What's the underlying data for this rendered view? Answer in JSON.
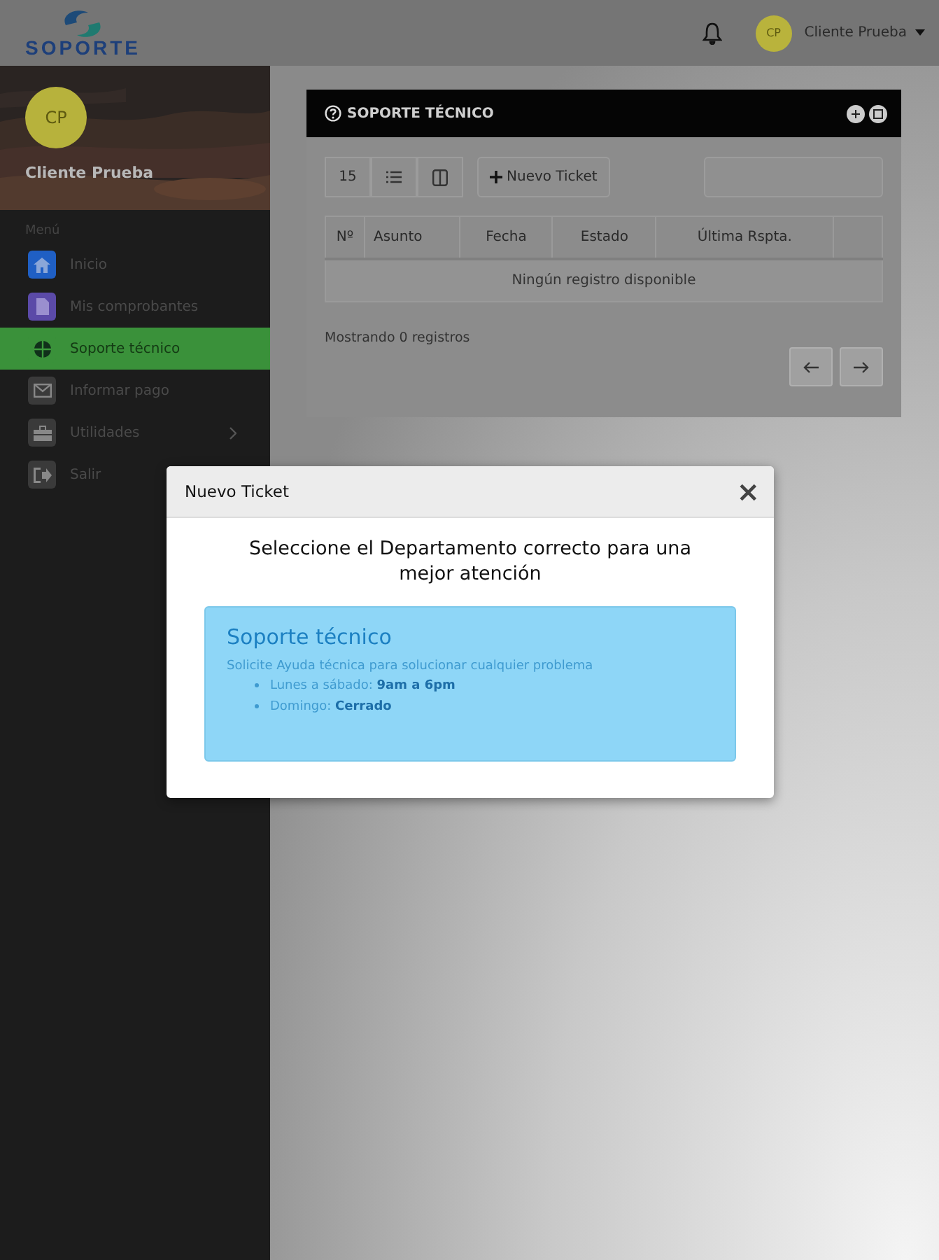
{
  "header": {
    "logo_text": "SOPORTE",
    "user": {
      "initials": "CP",
      "name": "Cliente Prueba"
    }
  },
  "sidebar": {
    "profile": {
      "initials": "CP",
      "name": "Cliente Prueba"
    },
    "section_label": "Menú",
    "items": [
      {
        "label": "Inicio",
        "kind": "home",
        "color": "#1f5fc4",
        "selected": false,
        "has_submenu": false
      },
      {
        "label": "Mis comprobantes",
        "kind": "document",
        "color": "#5b4aa8",
        "selected": false,
        "has_submenu": false
      },
      {
        "label": "Soporte técnico",
        "kind": "globe",
        "color": "#3a913a",
        "selected": true,
        "has_submenu": false
      },
      {
        "label": "Informar pago",
        "kind": "mail",
        "color": "#3a3a3a",
        "selected": false,
        "has_submenu": false
      },
      {
        "label": "Utilidades",
        "kind": "toolbox",
        "color": "#3a3a3a",
        "selected": false,
        "has_submenu": true
      },
      {
        "label": "Salir",
        "kind": "exit",
        "color": "#3a3a3a",
        "selected": false,
        "has_submenu": false
      }
    ]
  },
  "panel": {
    "title": "SOPORTE TÉCNICO",
    "page_size": "15",
    "new_button": "Nuevo Ticket",
    "columns": [
      "Nº",
      "Asunto",
      "Fecha",
      "Estado",
      "Última Rspta."
    ],
    "empty_message": "Ningún registro disponible",
    "footer": "Mostrando 0 registros"
  },
  "modal": {
    "title": "Nuevo Ticket",
    "close": "×",
    "heading": "Seleccione el Departamento correcto para una mejor atención",
    "departments": [
      {
        "title": "Soporte técnico",
        "description": "Solicite Ayuda técnica para solucionar cualquier problema",
        "hours": [
          "Lunes a sábado: **9am a 6pm**",
          "Domingo: **Cerrado**"
        ]
      }
    ]
  }
}
